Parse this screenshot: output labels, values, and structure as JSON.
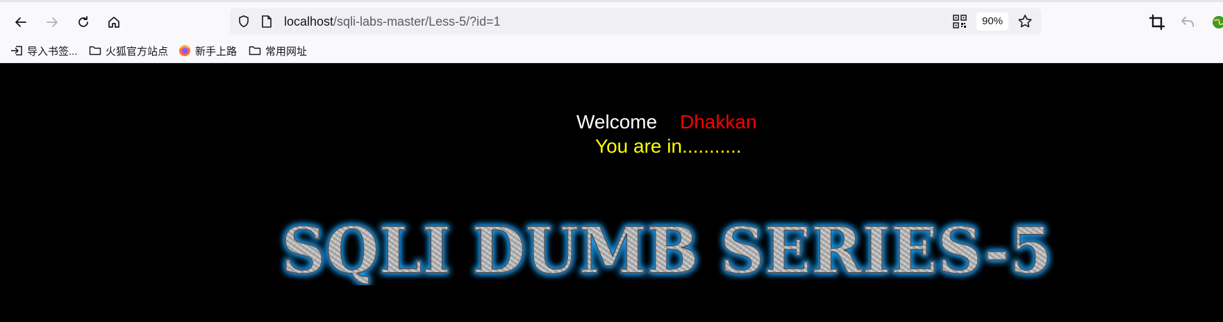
{
  "browser": {
    "url_host": "localhost",
    "url_path": "/sqli-labs-master/Less-5/?id=1",
    "zoom": "90%",
    "bookmarks": [
      {
        "label": "导入书签..."
      },
      {
        "label": "火狐官方站点"
      },
      {
        "label": "新手上路"
      },
      {
        "label": "常用网址"
      }
    ]
  },
  "page": {
    "welcome": "Welcome",
    "name": "Dhakkan",
    "status": "You are in...........",
    "banner": "SQLI DUMB SERIES-5"
  },
  "colors": {
    "background": "#000000",
    "welcome": "#ffffff",
    "name": "#ff0000",
    "status": "#ffff00",
    "banner_glow": "#1aa3ff"
  }
}
